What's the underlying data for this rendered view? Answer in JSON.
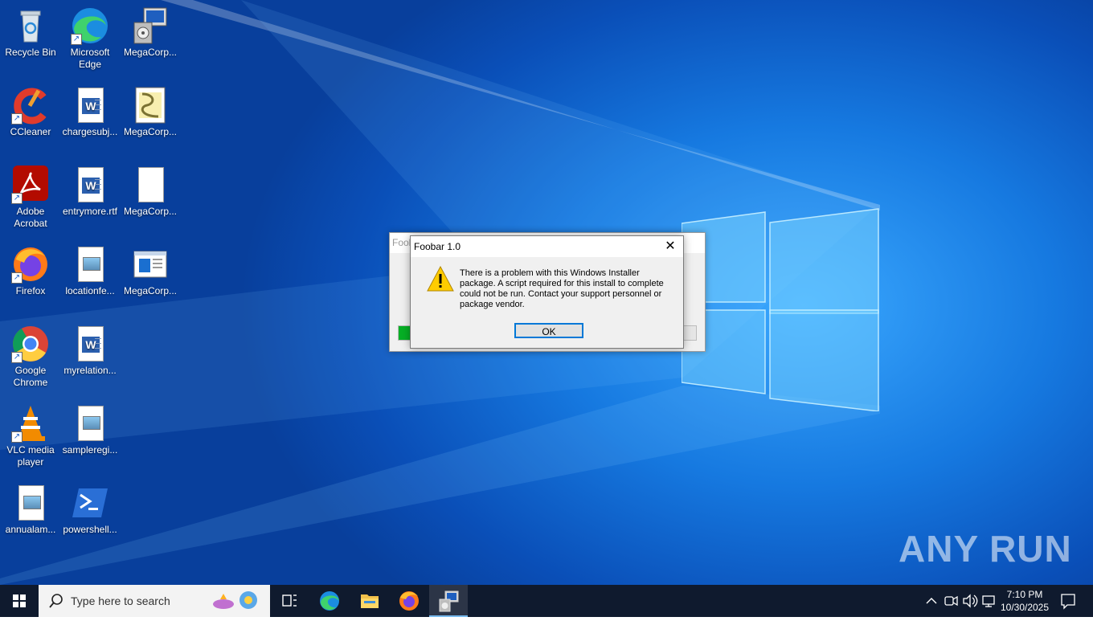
{
  "desktop": {
    "icons": [
      {
        "label": "Recycle Bin",
        "glyph": "recycle-bin"
      },
      {
        "label": "Microsoft Edge",
        "glyph": "edge"
      },
      {
        "label": "MegaCorp...",
        "glyph": "installer"
      },
      {
        "label": "CCleaner",
        "glyph": "ccleaner"
      },
      {
        "label": "chargesubj...",
        "glyph": "word-doc"
      },
      {
        "label": "MegaCorp...",
        "glyph": "script"
      },
      {
        "label": "Adobe Acrobat",
        "glyph": "acrobat"
      },
      {
        "label": "entrymore.rtf",
        "glyph": "word-doc"
      },
      {
        "label": "MegaCorp...",
        "glyph": "blank-file"
      },
      {
        "label": "Firefox",
        "glyph": "firefox"
      },
      {
        "label": "locationfe...",
        "glyph": "image-file"
      },
      {
        "label": "MegaCorp...",
        "glyph": "window-app"
      },
      {
        "label": "Google Chrome",
        "glyph": "chrome"
      },
      {
        "label": "myrelation...",
        "glyph": "word-doc"
      },
      {
        "label": "VLC media player",
        "glyph": "vlc"
      },
      {
        "label": "sampleregi...",
        "glyph": "image-file"
      },
      {
        "label": "annualam...",
        "glyph": "image-file"
      },
      {
        "label": "powershell...",
        "glyph": "powershell"
      }
    ],
    "watermark": "ANY RUN"
  },
  "background_window": {
    "title": "Foob",
    "progress_fraction": 0.04
  },
  "dialog": {
    "title": "Foobar 1.0",
    "message": "There is a problem with this Windows Installer package. A script required for this install to complete could not be run. Contact your support personnel or package vendor.",
    "ok_label": "OK"
  },
  "taskbar": {
    "search_placeholder": "Type here to search",
    "time": "7:10 PM",
    "date": "10/30/2025"
  },
  "colors": {
    "accent": "#0078d7",
    "progress": "#06b025",
    "taskbar": "#0f1a2e"
  }
}
